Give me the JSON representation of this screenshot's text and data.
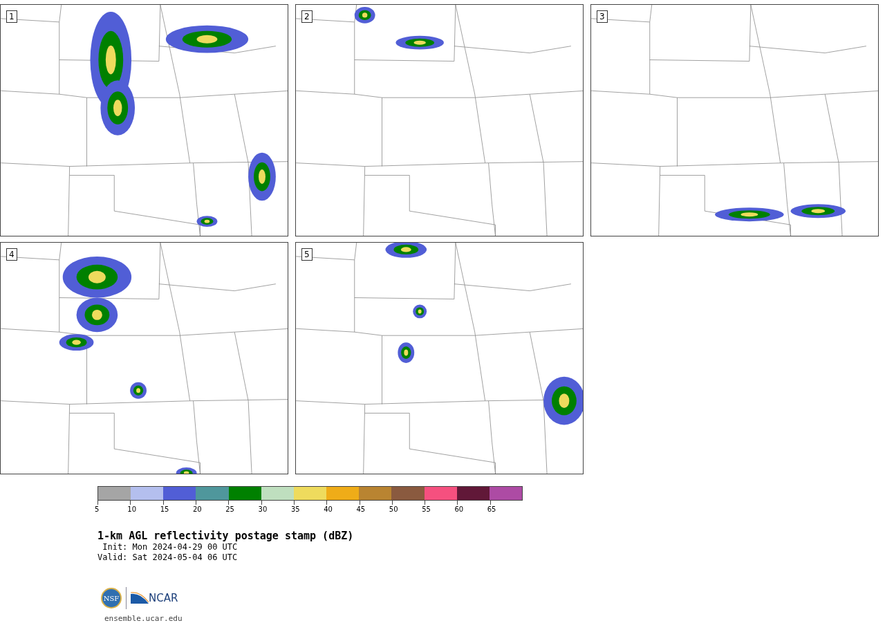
{
  "panels": [
    {
      "label": "1"
    },
    {
      "label": "2"
    },
    {
      "label": "3"
    },
    {
      "label": "4"
    },
    {
      "label": "5"
    }
  ],
  "colorbar": [
    {
      "color": "#a5a5a5",
      "tick": "5"
    },
    {
      "color": "#b4bfee",
      "tick": "10"
    },
    {
      "color": "#515ed6",
      "tick": "15"
    },
    {
      "color": "#4f979c",
      "tick": "20"
    },
    {
      "color": "#008000",
      "tick": "25"
    },
    {
      "color": "#bfdfbf",
      "tick": "30"
    },
    {
      "color": "#eedb5d",
      "tick": "35"
    },
    {
      "color": "#efac18",
      "tick": "40"
    },
    {
      "color": "#b98431",
      "tick": "45"
    },
    {
      "color": "#8a5a3f",
      "tick": "50"
    },
    {
      "color": "#f5507f",
      "tick": "55"
    },
    {
      "color": "#611838",
      "tick": "60"
    },
    {
      "color": "#ad4ba4",
      "tick": "65"
    }
  ],
  "title": "1-km AGL reflectivity postage stamp (dBZ)",
  "init": " Init: Mon 2024-04-29 00 UTC",
  "valid": "Valid: Sat 2024-05-04 06 UTC",
  "logo": {
    "left": "NSF",
    "right": "NCAR"
  },
  "footer": "ensemble.ucar.edu"
}
